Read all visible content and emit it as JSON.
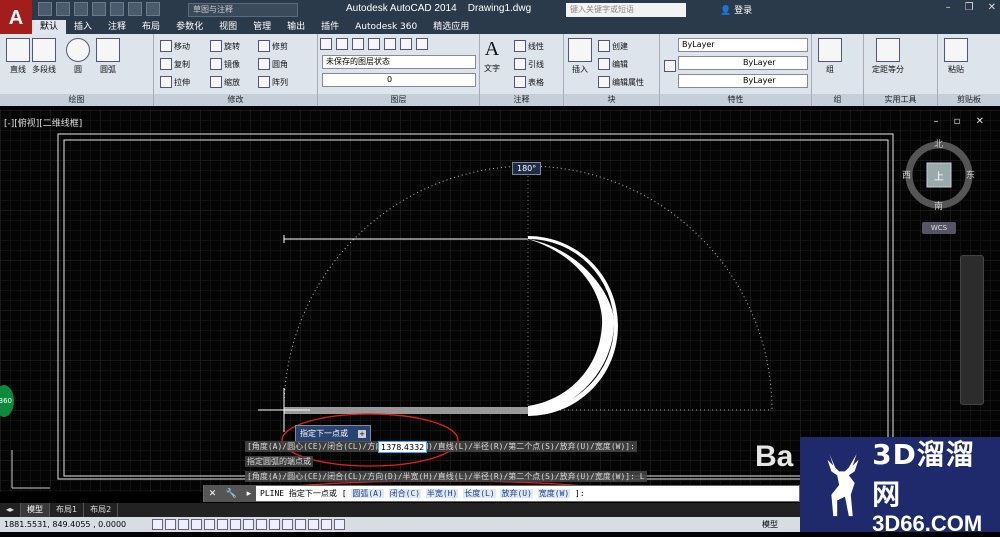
{
  "app": {
    "logo": "A",
    "title": "Autodesk AutoCAD 2014",
    "file": "Drawing1.dwg",
    "workspace": "草图与注释",
    "search_placeholder": "键入关键字或短语",
    "login": "登录"
  },
  "tabs": [
    "默认",
    "插入",
    "注释",
    "布局",
    "参数化",
    "视图",
    "管理",
    "输出",
    "插件",
    "Autodesk 360",
    "精选应用"
  ],
  "ribbon": {
    "draw": {
      "title": "绘图",
      "tools": [
        "直线",
        "多段线",
        "圆",
        "圆弧"
      ]
    },
    "modify": {
      "title": "修改",
      "tools": [
        "移动",
        "旋转",
        "修剪",
        "复制",
        "镜像",
        "圆角",
        "拉伸",
        "缩放",
        "阵列"
      ]
    },
    "layers": {
      "title": "图层",
      "state": "未保存的图层状态",
      "current": "0"
    },
    "annotation": {
      "title": "注释",
      "text": "文字",
      "tools": [
        "线性",
        "引线",
        "表格"
      ]
    },
    "block": {
      "title": "块",
      "insert": "插入",
      "tools": [
        "创建",
        "编辑",
        "编辑属性"
      ]
    },
    "properties": {
      "title": "特性",
      "values": [
        "ByLayer",
        "ByLayer",
        "ByLayer"
      ]
    },
    "groups": {
      "title": "组",
      "tool": "组"
    },
    "utilities": {
      "title": "实用工具",
      "tool": "定距等分"
    },
    "clipboard": {
      "title": "剪贴板",
      "tool": "粘贴"
    }
  },
  "viewport": {
    "label": "[-][俯视][二维线框]",
    "controls": "– ▫ ✕"
  },
  "viewcube": {
    "north": "北",
    "south": "南",
    "east": "东",
    "west": "西",
    "top": "上",
    "wcs": "WCS"
  },
  "drawing": {
    "angle_tooltip": "180°",
    "prompt_label": "指定下一点或",
    "dynamic_input": "1378.4332",
    "history": [
      "[角度(A)/圆心(CE)/闭合(CL)/方向(D)/半宽(H)/直线(L)/半径(R)/第二个点(S)/放弃(U)/宽度(W)]:",
      "指定圆弧的端点或",
      "[角度(A)/圆心(CE)/闭合(CL)/方向(D)/半宽(H)/直线(L)/半径(R)/第二个点(S)/放弃(U)/宽度(W)]: L"
    ]
  },
  "command": {
    "prefix": "PLINE 指定下一点或 [",
    "options": [
      "圆弧(A)",
      "闭合(C)",
      "半宽(H)",
      "长度(L)",
      "放弃(U)",
      "宽度(W)"
    ],
    "suffix": "]:"
  },
  "layout_tabs": [
    "模型",
    "布局1",
    "布局2"
  ],
  "status": {
    "coords": "1881.5531, 849.4055 , 0.0000",
    "model": "模型"
  },
  "badges": {
    "g360": "360"
  },
  "watermark": {
    "cn": "3D溜溜网",
    "url": "3D66.COM",
    "baidu": "Ba"
  }
}
